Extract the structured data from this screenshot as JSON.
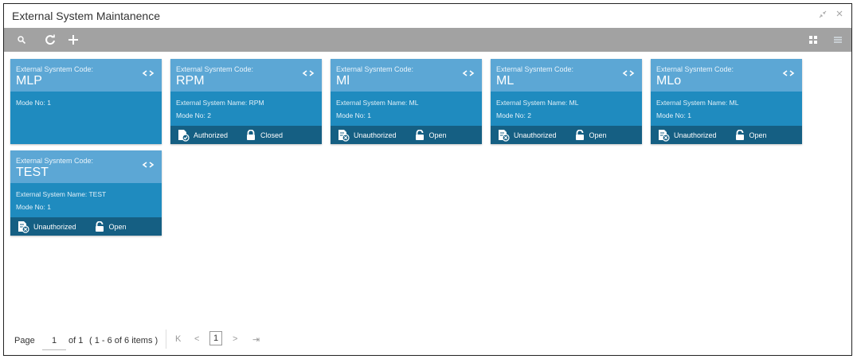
{
  "window": {
    "title": "External System Maintanence",
    "minimize": "↘↗",
    "close": "✕"
  },
  "toolbar": {
    "search_icon": "search-icon",
    "refresh_icon": "refresh-icon",
    "add_icon": "plus-icon",
    "grid_view_icon": "grid-view-icon",
    "list_view_icon": "list-view-icon"
  },
  "colors": {
    "toolbar_bg": "#a2a2a2",
    "tile_head": "#5ca7d5",
    "tile_body": "#1f8bbf",
    "tile_foot": "#155f83"
  },
  "tiles": [
    {
      "code_label": "External Sysntem Code:",
      "code": "MLP",
      "name_line": "",
      "mode_line": "Mode No: 1",
      "auth_status": "",
      "record_status": ""
    },
    {
      "code_label": "External Sysntem Code:",
      "code": "RPM",
      "name_line": "External System Name: RPM",
      "mode_line": "Mode No: 2",
      "auth_status": "Authorized",
      "record_status": "Closed"
    },
    {
      "code_label": "External Sysntem Code:",
      "code": "Ml",
      "name_line": "External System Name: ML",
      "mode_line": "Mode No: 1",
      "auth_status": "Unauthorized",
      "record_status": "Open"
    },
    {
      "code_label": "External Sysntem Code:",
      "code": "ML",
      "name_line": "External System Name: ML",
      "mode_line": "Mode No: 2",
      "auth_status": "Unauthorized",
      "record_status": "Open"
    },
    {
      "code_label": "External Sysntem Code:",
      "code": "MLo",
      "name_line": "External System Name: ML",
      "mode_line": "Mode No: 1",
      "auth_status": "Unauthorized",
      "record_status": "Open"
    },
    {
      "code_label": "External Sysntem Code:",
      "code": "TEST",
      "name_line": "External System Name: TEST",
      "mode_line": "Mode No: 1",
      "auth_status": "Unauthorized",
      "record_status": "Open"
    }
  ],
  "pager": {
    "page_label": "Page",
    "page_value": "1",
    "of_label": "of 1",
    "items_label": "( 1 - 6 of 6 items )",
    "first": "K",
    "prev": "<",
    "current": "1",
    "next": ">",
    "last": "⇥"
  }
}
